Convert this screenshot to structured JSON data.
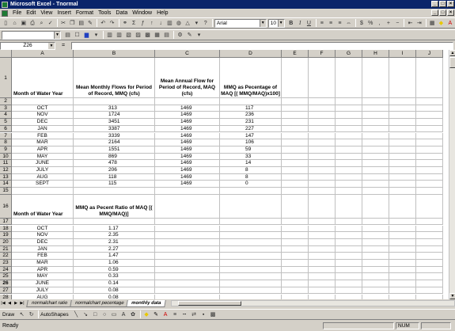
{
  "window": {
    "title": "Microsoft Excel - Tnormal"
  },
  "menu": [
    "File",
    "Edit",
    "View",
    "Insert",
    "Format",
    "Tools",
    "Data",
    "Window",
    "Help"
  ],
  "toolbar": {
    "font_name": "Arial",
    "font_size": "10"
  },
  "formula_bar": {
    "cell_ref": "Z26",
    "eq": "="
  },
  "columns": [
    "A",
    "B",
    "C",
    "D",
    "E",
    "F",
    "G",
    "H",
    "I",
    "J"
  ],
  "headers": {
    "a1": "Month of Water Year",
    "b1": "Mean Monthly Flows for Period of Record, MMQ (cfs)",
    "c1": "Mean Annual Flow for Period of Record, MAQ (cfs)",
    "d1": "MMQ as Pecentage of MAQ [( MMQ/MAQ)x100]",
    "a16": "Month of Water Year",
    "b16": "MMQ as Pecent Ratio of MAQ [( MMQ/MAQ)]"
  },
  "table1": [
    [
      "OCT",
      "313",
      "1469",
      "117"
    ],
    [
      "NOV",
      "1724",
      "1469",
      "236"
    ],
    [
      "DEC",
      "3451",
      "1469",
      "231"
    ],
    [
      "JAN",
      "3387",
      "1469",
      "227"
    ],
    [
      "FEB",
      "3339",
      "1469",
      "147"
    ],
    [
      "MAR",
      "2164",
      "1469",
      "106"
    ],
    [
      "APR",
      "1551",
      "1469",
      "59"
    ],
    [
      "MAY",
      "869",
      "1469",
      "33"
    ],
    [
      "JUNE",
      "478",
      "1469",
      "14"
    ],
    [
      "JULY",
      "206",
      "1469",
      "8"
    ],
    [
      "AUG",
      "118",
      "1469",
      "8"
    ],
    [
      "SEPT",
      "115",
      "1469",
      "0"
    ]
  ],
  "table2": [
    [
      "OCT",
      "1.17"
    ],
    [
      "NOV",
      "2.35"
    ],
    [
      "DEC",
      "2.31"
    ],
    [
      "JAN",
      "2.27"
    ],
    [
      "FEB",
      "1.47"
    ],
    [
      "MAR",
      "1.06"
    ],
    [
      "APR",
      "0.59"
    ],
    [
      "MAY",
      "0.33"
    ],
    [
      "JUNE",
      "0.14"
    ],
    [
      "JULY",
      "0.08"
    ],
    [
      "AUG",
      "0.08"
    ],
    [
      "SEPT",
      "0.00"
    ]
  ],
  "sheets": [
    "normalchart ratio",
    "normalchart pecentage",
    "monthly data"
  ],
  "drawbar": {
    "draw": "Draw",
    "autoshapes": "AutoShapes"
  },
  "status": {
    "left": "Ready",
    "num": "NUM"
  }
}
